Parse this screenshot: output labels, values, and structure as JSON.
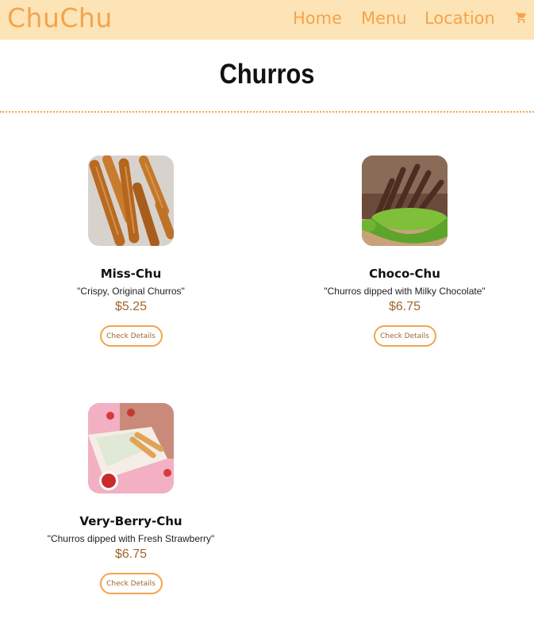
{
  "nav": {
    "brand": "ChuChu",
    "links": [
      "Home",
      "Menu",
      "Location"
    ],
    "cart_icon": "cart-icon"
  },
  "page": {
    "title": "Churros"
  },
  "colors": {
    "accent": "#f5a34a",
    "navbar_bg": "#fde4b6",
    "price": "#a0672a"
  },
  "products": [
    {
      "name": "Miss-Chu",
      "description": "\"Crispy, Original Churros\"",
      "price": "$5.25",
      "button": "Check Details"
    },
    {
      "name": "Choco-Chu",
      "description": "\"Churros dipped with Milky Chocolate\"",
      "price": "$6.75",
      "button": "Check Details"
    },
    {
      "name": "Very-Berry-Chu",
      "description": "\"Churros dipped with Fresh Strawberry\"",
      "price": "$6.75",
      "button": "Check Details"
    }
  ]
}
